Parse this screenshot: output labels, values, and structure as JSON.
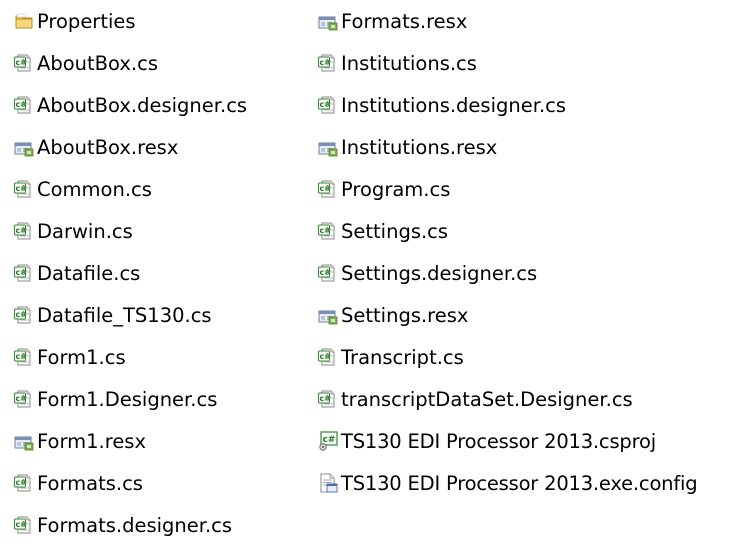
{
  "explorer": {
    "columns": [
      [
        {
          "name": "Properties",
          "icon": "folder-icon"
        },
        {
          "name": "AboutBox.cs",
          "icon": "csharp-file-icon"
        },
        {
          "name": "AboutBox.designer.cs",
          "icon": "csharp-file-icon"
        },
        {
          "name": "AboutBox.resx",
          "icon": "resx-file-icon"
        },
        {
          "name": "Common.cs",
          "icon": "csharp-file-icon"
        },
        {
          "name": "Darwin.cs",
          "icon": "csharp-file-icon"
        },
        {
          "name": "Datafile.cs",
          "icon": "csharp-file-icon"
        },
        {
          "name": "Datafile_TS130.cs",
          "icon": "csharp-file-icon"
        },
        {
          "name": "Form1.cs",
          "icon": "csharp-file-icon"
        },
        {
          "name": "Form1.Designer.cs",
          "icon": "csharp-file-icon"
        },
        {
          "name": "Form1.resx",
          "icon": "resx-file-icon"
        },
        {
          "name": "Formats.cs",
          "icon": "csharp-file-icon"
        },
        {
          "name": "Formats.designer.cs",
          "icon": "csharp-file-icon"
        }
      ],
      [
        {
          "name": "Formats.resx",
          "icon": "resx-file-icon"
        },
        {
          "name": "Institutions.cs",
          "icon": "csharp-file-icon"
        },
        {
          "name": "Institutions.designer.cs",
          "icon": "csharp-file-icon"
        },
        {
          "name": "Institutions.resx",
          "icon": "resx-file-icon"
        },
        {
          "name": "Program.cs",
          "icon": "csharp-file-icon"
        },
        {
          "name": "Settings.cs",
          "icon": "csharp-file-icon"
        },
        {
          "name": "Settings.designer.cs",
          "icon": "csharp-file-icon"
        },
        {
          "name": "Settings.resx",
          "icon": "resx-file-icon"
        },
        {
          "name": "Transcript.cs",
          "icon": "csharp-file-icon"
        },
        {
          "name": "transcriptDataSet.Designer.cs",
          "icon": "csharp-file-icon"
        },
        {
          "name": "TS130 EDI Processor 2013.csproj",
          "icon": "csproj-file-icon"
        },
        {
          "name": "TS130 EDI Processor 2013.exe.config",
          "icon": "config-file-icon"
        }
      ]
    ]
  }
}
